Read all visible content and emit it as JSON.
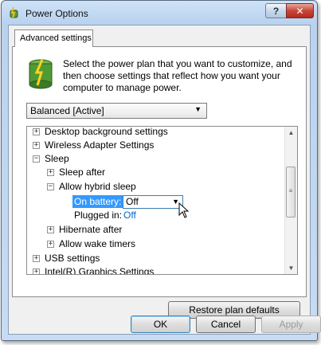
{
  "window": {
    "title": "Power Options",
    "help_label": "?",
    "close_label": "✕"
  },
  "tab": {
    "label": "Advanced settings"
  },
  "intro": {
    "text": "Select the power plan that you want to customize, and then choose settings that reflect how you want your computer to manage power."
  },
  "plan_select": {
    "value": "Balanced [Active]",
    "arrow": "▼"
  },
  "tree": {
    "items": [
      {
        "label": "Desktop background settings",
        "expander": "+"
      },
      {
        "label": "Wireless Adapter Settings",
        "expander": "+"
      },
      {
        "label": "Sleep",
        "expander": "−"
      },
      {
        "label": "Sleep after",
        "expander": "+"
      },
      {
        "label": "Allow hybrid sleep",
        "expander": "−"
      },
      {
        "label": "Plugged in:",
        "value": "Off"
      },
      {
        "label": "Hibernate after",
        "expander": "+"
      },
      {
        "label": "Allow wake timers",
        "expander": "+"
      },
      {
        "label": "USB settings",
        "expander": "+"
      },
      {
        "label": "Intel(R) Graphics Settings",
        "expander": "+"
      }
    ],
    "on_battery": {
      "label": "On battery:",
      "value": "Off",
      "arrow": "▼"
    }
  },
  "scrollbar": {
    "up": "▲",
    "down": "▼",
    "grip": "≡"
  },
  "buttons": {
    "restore": "Restore plan defaults",
    "ok": "OK",
    "cancel": "Cancel",
    "apply": "Apply"
  }
}
